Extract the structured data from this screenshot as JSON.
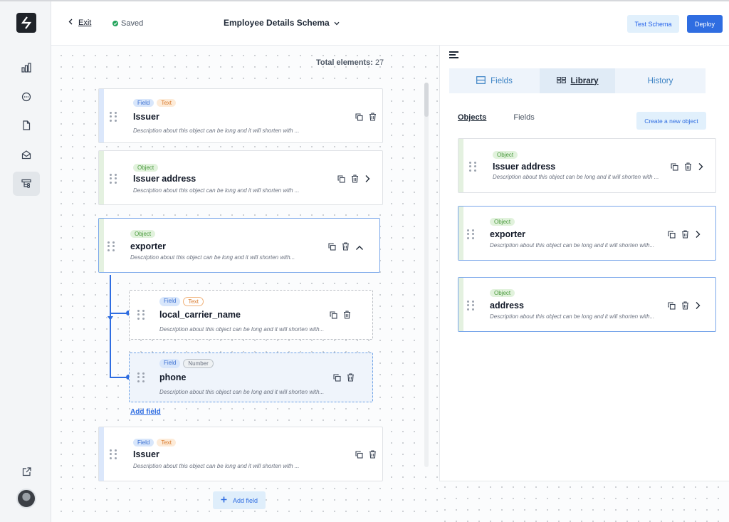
{
  "header": {
    "exit_label": "Exit",
    "saved_label": "Saved",
    "schema_title": "Employee Details Schema",
    "test_schema_label": "Test Schema",
    "deploy_label": "Deploy"
  },
  "canvas": {
    "total_label": "Total elements:",
    "total_value": "27",
    "add_field_link": "Add field",
    "add_field_button": "Add field",
    "cards": [
      {
        "tag1": "Field",
        "tag2": "Text",
        "title": "Issuer",
        "description": "Description about this object can be long and it will shorten with ..."
      },
      {
        "tag1": "Object",
        "title": "Issuer address",
        "description": "Description about this object can be long and it will shorten with ..."
      },
      {
        "tag1": "Object",
        "title": "exporter",
        "description": "Description about this object can be long and it will shorten with..."
      },
      {
        "tag1": "Field",
        "tag2": "Text",
        "title": "local_carrier_name",
        "description": "Description about this object can be long and it will shorten with..."
      },
      {
        "tag1": "Field",
        "tag2": "Number",
        "title": "phone",
        "description": "Description about this object can be long and it will shorten with..."
      },
      {
        "tag1": "Field",
        "tag2": "Text",
        "title": "Issuer",
        "description": "Description about this object can be long and it will shorten with ..."
      }
    ]
  },
  "panel": {
    "tabs": [
      {
        "label": "Fields",
        "icon": "fields-icon"
      },
      {
        "label": "Library",
        "icon": "library-icon"
      },
      {
        "label": "History"
      }
    ],
    "subtabs": [
      "Objects",
      "Fields"
    ],
    "create_object_label": "Create a new object",
    "objects": [
      {
        "tag": "Object",
        "title": "Issuer address",
        "description": "Description about this object can be long and it will shorten with ..."
      },
      {
        "tag": "Object",
        "title": "exporter",
        "description": "Description about this object can be long and it will shorten with..."
      },
      {
        "tag": "Object",
        "title": "address",
        "description": "Description about this object can be long and it will shorten with..."
      }
    ]
  },
  "colors": {
    "accent": "#2f6de1",
    "field_tag": "#d8e6fb",
    "text_tag": "#fdebd8",
    "object_tag": "#e1f2dc",
    "saved_status": "#22a35a"
  }
}
